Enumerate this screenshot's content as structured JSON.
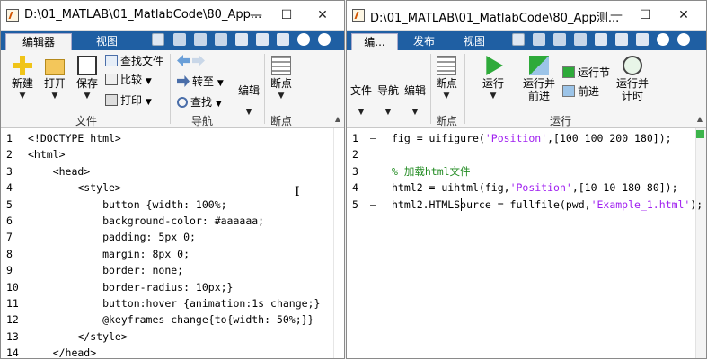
{
  "left_window": {
    "title": "D:\\01_MATLAB\\01_MatlabCode\\80_App...",
    "tabs": [
      "编辑器",
      "视图"
    ],
    "ribbon": {
      "new": "新建",
      "open": "打开",
      "save": "保存",
      "find_files": "查找文件",
      "compare": "比较",
      "print": "打印",
      "goto": "转至",
      "find": "查找",
      "edit": "编辑",
      "breakpoints": "断点",
      "group_file": "文件",
      "group_nav": "导航",
      "group_bp": "断点"
    },
    "code_lines": [
      {
        "n": "1",
        "text": "<!DOCTYPE html>"
      },
      {
        "n": "2",
        "text": "<html>"
      },
      {
        "n": "3",
        "text": "    <head>"
      },
      {
        "n": "4",
        "text": "        <style>"
      },
      {
        "n": "5",
        "text": "            button {width: 100%;"
      },
      {
        "n": "6",
        "text": "            background-color: #aaaaaa;"
      },
      {
        "n": "7",
        "text": "            padding: 5px 0;"
      },
      {
        "n": "8",
        "text": "            margin: 8px 0;"
      },
      {
        "n": "9",
        "text": "            border: none;"
      },
      {
        "n": "10",
        "text": "            border-radius: 10px;}"
      },
      {
        "n": "11",
        "text": "            button:hover {animation:1s change;}"
      },
      {
        "n": "12",
        "text": "            @keyframes change{to{width: 50%;}}"
      },
      {
        "n": "13",
        "text": "        </style>"
      },
      {
        "n": "14",
        "text": "    </head>"
      }
    ]
  },
  "right_window": {
    "title": "D:\\01_MATLAB\\01_MatlabCode\\80_App测...",
    "tabs": [
      "编...",
      "发布",
      "视图"
    ],
    "ribbon": {
      "file": "文件",
      "nav": "导航",
      "edit": "编辑",
      "breakpoints": "断点",
      "run": "运行",
      "run_advance_1": "运行并",
      "run_advance_2": "前进",
      "run_section": "运行节",
      "advance": "前进",
      "run_time_1": "运行并",
      "run_time_2": "计时",
      "group_bp": "断点",
      "group_run": "运行"
    },
    "code_lines": [
      {
        "n": "1",
        "mark": "—",
        "parts": [
          [
            "",
            "fig = uifigure("
          ],
          [
            "str",
            "'Position'"
          ],
          [
            "",
            ",[100 100 200 180]);"
          ]
        ]
      },
      {
        "n": "2",
        "mark": "",
        "parts": []
      },
      {
        "n": "3",
        "mark": "",
        "parts": [
          [
            "cmt",
            "% 加载html文件"
          ]
        ]
      },
      {
        "n": "4",
        "mark": "—",
        "parts": [
          [
            "",
            "html2 = uihtml(fig,"
          ],
          [
            "str",
            "'Position'"
          ],
          [
            "",
            ",[10 10 180 80]);"
          ]
        ]
      },
      {
        "n": "5",
        "mark": "—",
        "parts": [
          [
            "",
            "html2.HTMLSource = fullfile(pwd,"
          ],
          [
            "str",
            "'Example_1.html'"
          ],
          [
            "",
            ");"
          ]
        ]
      }
    ]
  },
  "colors": {
    "tabbar": "#1f5fa3",
    "string": "#a020f0",
    "comment": "#228b22",
    "ok": "#3cb44b"
  },
  "icons": {
    "minimize": "—",
    "maximize": "☐",
    "close": "✕",
    "dropdown": "▼",
    "collapse": "▲"
  }
}
